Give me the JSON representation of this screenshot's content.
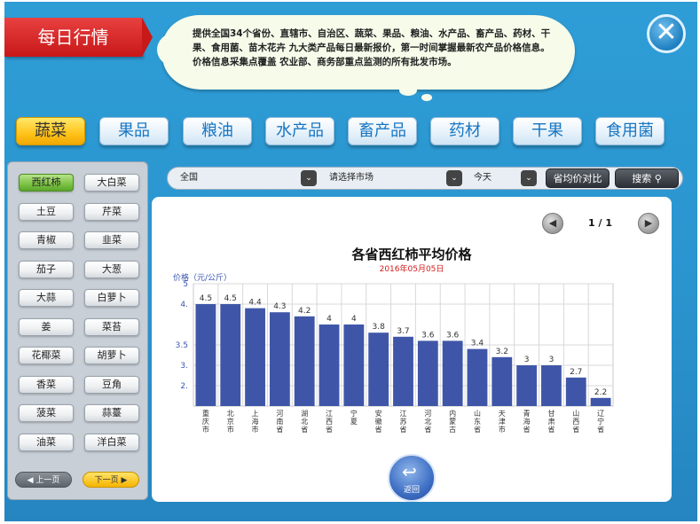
{
  "header": {
    "title": "每日行情",
    "info_line1": "提供全国34个省份、直辖市、自治区、蔬菜、果品、粮油、水产品、畜产品、药材、干",
    "info_line2": "果、食用菌、苗木花卉 九大类产品每日最新报价，第一时间掌握最新农产品价格信息。",
    "info_line3": "价格信息采集点覆盖 农业部、商务部重点监测的所有批发市场。",
    "close_glyph": "✕"
  },
  "tabs": [
    "蔬菜",
    "果品",
    "粮油",
    "水产品",
    "畜产品",
    "药材",
    "干果",
    "食用菌"
  ],
  "active_tab": 0,
  "vegetables": [
    "西红柿",
    "大白菜",
    "土豆",
    "芹菜",
    "青椒",
    "韭菜",
    "茄子",
    "大葱",
    "大蒜",
    "白萝卜",
    "姜",
    "菜苔",
    "花椰菜",
    "胡萝卜",
    "香菜",
    "豆角",
    "菠菜",
    "蒜薹",
    "油菜",
    "洋白菜"
  ],
  "active_vegetable": 0,
  "pager": {
    "prev": "上一页",
    "next": "下一页"
  },
  "filters": {
    "region": "全国",
    "market": "请选择市场",
    "date": "今天",
    "compare_button": "省均价对比",
    "search_button": "搜索"
  },
  "chart_nav": {
    "page": "1 / 1"
  },
  "return_button": "返回",
  "colors": {
    "bar": "#3f56a8",
    "accent_red": "#d21c1c",
    "active_tab": "#ffc21a",
    "active_item": "#7cc243"
  },
  "chart_data": {
    "type": "bar",
    "title": "各省西红柿平均价格",
    "subtitle": "2016年05月05日",
    "ylabel": "价格（元/公斤）",
    "categories": [
      "重庆市",
      "北京市",
      "上海市",
      "河南省",
      "湖北省",
      "江西省",
      "宁夏",
      "安徽省",
      "江苏省",
      "河北省",
      "内蒙古",
      "山东省",
      "天津市",
      "青海省",
      "甘肃省",
      "山西省",
      "辽宁省"
    ],
    "values": [
      4.5,
      4.5,
      4.4,
      4.3,
      4.2,
      4,
      4,
      3.8,
      3.7,
      3.6,
      3.6,
      3.4,
      3.2,
      3,
      3,
      2.7,
      2.2
    ],
    "value_labels": [
      "4.5",
      "4.5",
      "4.4",
      "4.3",
      "4.2",
      "4",
      "4",
      "3.8",
      "3.7",
      "3.6",
      "3.6",
      "3.4",
      "3.2",
      "3",
      "3",
      "2.7",
      "2.2"
    ],
    "ytick_labels": [
      "5",
      "4.",
      "3.5",
      "3.",
      "2."
    ],
    "ytick_values": [
      5,
      4.5,
      3.5,
      3,
      2.5
    ],
    "ylim": [
      2,
      5
    ],
    "grid": true
  }
}
